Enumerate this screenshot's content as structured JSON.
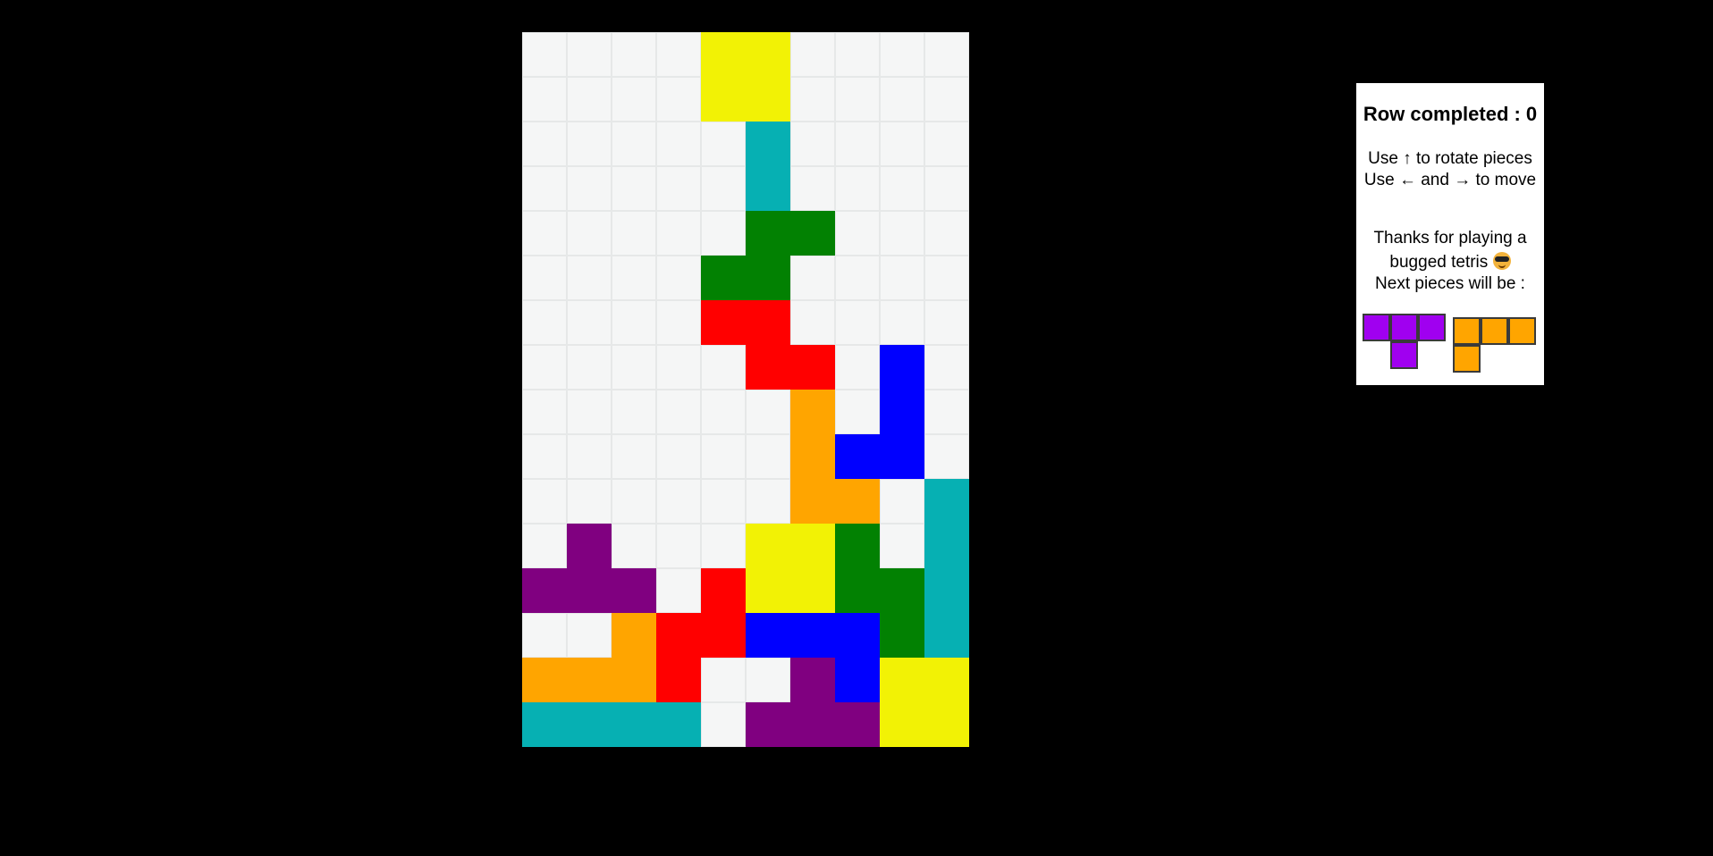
{
  "game": {
    "grid": [
      "....YY....",
      "....YY....",
      ".....C....",
      ".....C....",
      ".....GG...",
      "....GG....",
      "....RR....",
      ".....RR.B.",
      "......O.B.",
      "......OBB.",
      "......OO.C",
      ".P...YYG.C",
      "PPP.RYYGGC",
      "..ORRBBBGC",
      "OOOR..PBYY",
      "CCCC.PPPYY"
    ],
    "colors": {
      "Y": "#f2f205",
      "C": "#06b0b3",
      "G": "#028102",
      "R": "#ff0000",
      "B": "#0000ff",
      "O": "#ffa500",
      "P": "#800080"
    }
  },
  "panel": {
    "score_label": "Row completed : 0",
    "instructions": [
      "Use ↑ to rotate pieces",
      "Use ← and → to move"
    ],
    "thanks_line1": "Thanks for playing a",
    "thanks_line2": "bugged tetris",
    "emoji_icon": "sunglasses-face-icon",
    "next_label": "Next pieces will be :",
    "next_pieces": [
      {
        "name": "T",
        "color": "#a000f0",
        "cells": [
          [
            0,
            0
          ],
          [
            1,
            0
          ],
          [
            2,
            0
          ],
          [
            1,
            1
          ]
        ]
      },
      {
        "name": "L",
        "color": "#ffa500",
        "cells": [
          [
            0,
            0
          ],
          [
            1,
            0
          ],
          [
            2,
            0
          ],
          [
            0,
            1
          ]
        ]
      }
    ]
  }
}
